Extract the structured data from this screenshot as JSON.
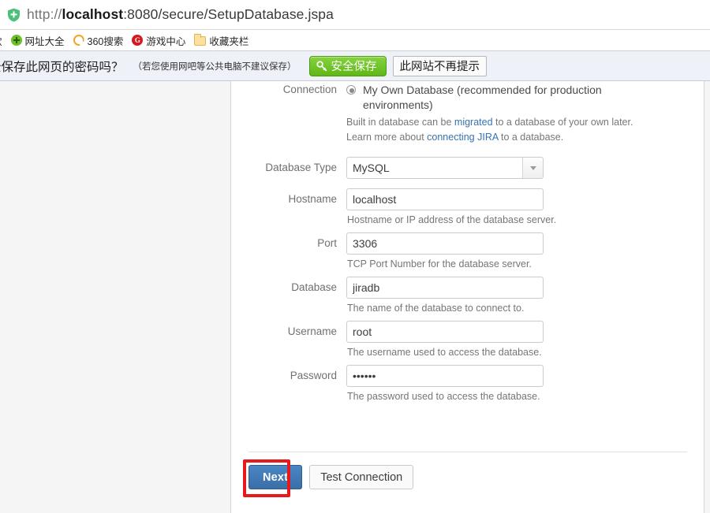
{
  "browser": {
    "url_prefix": "http://",
    "url_host": "localhost",
    "url_rest": ":8080/secure/SetupDatabase.jspa",
    "security_icon": "shield-icon",
    "bookmarks": [
      {
        "label": "歌",
        "icon": "google-icon"
      },
      {
        "label": "网址大全",
        "icon": "green-plus-icon"
      },
      {
        "label": "360搜索",
        "icon": "orange-circle-icon"
      },
      {
        "label": "游戏中心",
        "icon": "red-g-icon"
      },
      {
        "label": "收藏夹栏",
        "icon": "folder-icon"
      }
    ]
  },
  "notification": {
    "message": "全保存此网页的密码吗？",
    "note": "（若您使用网吧等公共电脑不建议保存）",
    "save_label": "安全保存",
    "save_icon": "key-icon",
    "dismiss_label": "此网站不再提示"
  },
  "form": {
    "connection_label": "Connection",
    "radio_option": {
      "label": "My Own Database (recommended for production environments)",
      "selected": true
    },
    "hints": {
      "line1_pre": "Built in database can be ",
      "line1_link": "migrated",
      "line1_post": " to a database of your own later.",
      "line2_pre": "Learn more about ",
      "line2_link": "connecting JIRA",
      "line2_post": " to a database."
    },
    "fields": [
      {
        "label": "Database Type",
        "type": "select",
        "value": "MySQL",
        "help": ""
      },
      {
        "label": "Hostname",
        "type": "text",
        "value": "localhost",
        "help": "Hostname or IP address of the database server."
      },
      {
        "label": "Port",
        "type": "text",
        "value": "3306",
        "help": "TCP Port Number for the database server."
      },
      {
        "label": "Database",
        "type": "text",
        "value": "jiradb",
        "help": "The name of the database to connect to."
      },
      {
        "label": "Username",
        "type": "text",
        "value": "root",
        "help": "The username used to access the database."
      },
      {
        "label": "Password",
        "type": "password",
        "value": "••••••",
        "help": "The password used to access the database."
      }
    ],
    "actions": {
      "next_label": "Next",
      "test_label": "Test Connection"
    }
  },
  "colors": {
    "link": "#3572b0",
    "primary_button": "#3a6fa8",
    "highlight": "#e8191d",
    "save_button": "#5fb716"
  }
}
